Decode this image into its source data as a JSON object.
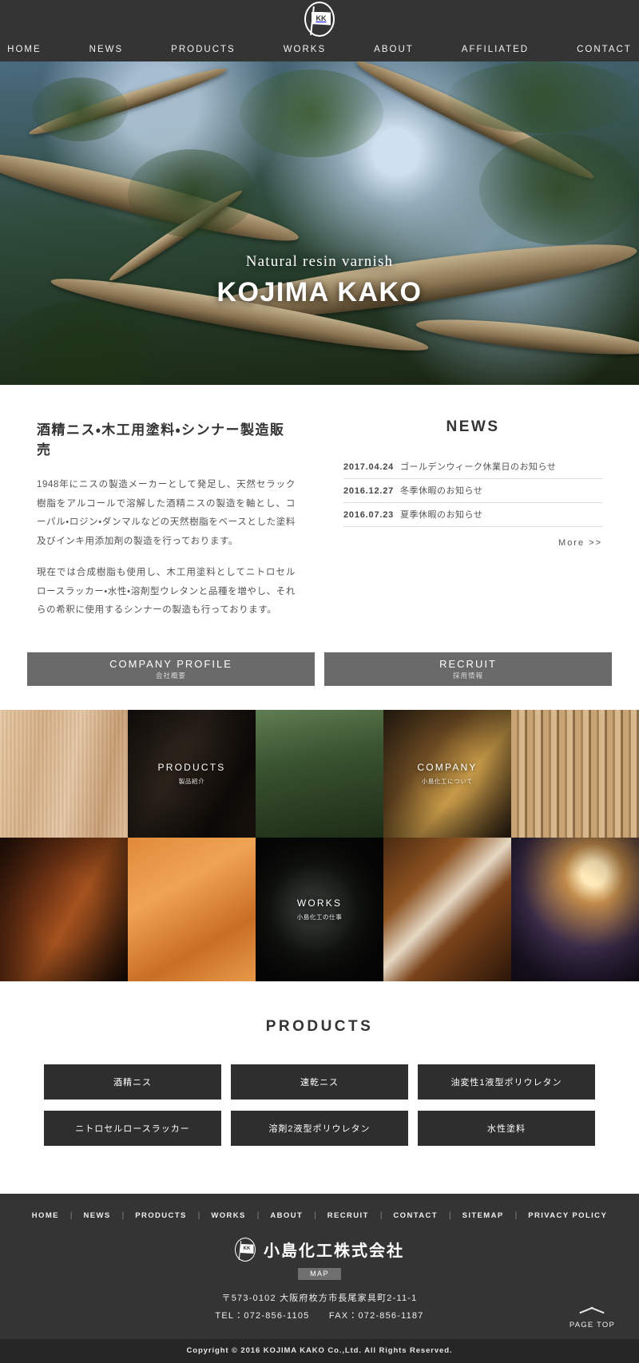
{
  "header": {
    "logo": {
      "mark": "KK",
      "name": "kojima-kako-logo"
    },
    "nav": [
      {
        "label": "HOME"
      },
      {
        "label": "NEWS"
      },
      {
        "label": "PRODUCTS"
      },
      {
        "label": "WORKS"
      },
      {
        "label": "ABOUT"
      },
      {
        "label": "AFFILIATED"
      },
      {
        "label": "CONTACT"
      }
    ]
  },
  "hero": {
    "subtitle": "Natural resin varnish",
    "title": "KOJIMA KAKO"
  },
  "intro": {
    "heading": "酒精ニス・木工用塗料・シンナー製造販売",
    "paragraph1": "1948年にニスの製造メーカーとして発足し、天然セラック樹脂をアルコールで溶解した酒精ニスの製造を軸とし、コーパル・ロジン・ダンマルなどの天然樹脂をベースとした塗料及びインキ用添加剤の製造を行っております。",
    "paragraph2": "現在では合成樹脂も使用し、木工用塗料としてニトロセルロースラッカー・水性・溶剤型ウレタンと品種を増やし、それらの希釈に使用するシンナーの製造も行っております。"
  },
  "news": {
    "heading": "NEWS",
    "items": [
      {
        "date": "2017.04.24",
        "title": "ゴールデンウィーク休業日のお知らせ"
      },
      {
        "date": "2016.12.27",
        "title": "冬季休暇のお知らせ"
      },
      {
        "date": "2016.07.23",
        "title": "夏季休暇のお知らせ"
      }
    ],
    "more": "More >>"
  },
  "cta": [
    {
      "main": "COMPANY PROFILE",
      "sub": "会社概要"
    },
    {
      "main": "RECRUIT",
      "sub": "採用情報"
    }
  ],
  "grid_tiles": [
    {
      "caption": "",
      "sub": "",
      "texture": "tx-wood-light"
    },
    {
      "caption": "PRODUCTS",
      "sub": "製品紹介",
      "texture": "tx-dark-wood"
    },
    {
      "caption": "",
      "sub": "",
      "texture": "tx-tree"
    },
    {
      "caption": "COMPANY",
      "sub": "小島化工について",
      "texture": "tx-chairs"
    },
    {
      "caption": "",
      "sub": "",
      "texture": "tx-fence"
    },
    {
      "caption": "",
      "sub": "",
      "texture": "tx-violin"
    },
    {
      "caption": "",
      "sub": "",
      "texture": "tx-table"
    },
    {
      "caption": "WORKS",
      "sub": "小島化工の仕事",
      "texture": "tx-swirl"
    },
    {
      "caption": "",
      "sub": "",
      "texture": "tx-curve"
    },
    {
      "caption": "",
      "sub": "",
      "texture": "tx-lamp"
    }
  ],
  "products": {
    "heading": "PRODUCTS",
    "items": [
      {
        "label": "酒精ニス"
      },
      {
        "label": "速乾ニス"
      },
      {
        "label": "油変性1液型ポリウレタン"
      },
      {
        "label": "ニトロセルロースラッカー"
      },
      {
        "label": "溶剤2液型ポリウレタン"
      },
      {
        "label": "水性塗料"
      }
    ]
  },
  "footer": {
    "nav": [
      {
        "label": "HOME"
      },
      {
        "label": "NEWS"
      },
      {
        "label": "PRODUCTS"
      },
      {
        "label": "WORKS"
      },
      {
        "label": "ABOUT"
      },
      {
        "label": "RECRUIT"
      },
      {
        "label": "CONTACT"
      },
      {
        "label": "SITEMAP"
      },
      {
        "label": "PRIVACY POLICY"
      }
    ],
    "logo_mark": "KK",
    "company_name": "小島化工株式会社",
    "map_label": "MAP",
    "address": "〒573-0102 大阪府枚方市長尾家具町2-11-1",
    "phone_fax": "TEL：072-856-1105　　FAX：072-856-1187",
    "page_top": "PAGE TOP",
    "copyright": "Copyright © 2016 KOJIMA KAKO Co.,Ltd. All Rights Reserved."
  },
  "colors": {
    "dark": "#343434",
    "darker": "#262626",
    "button_gray": "#6a6a6a",
    "product_btn": "#2e2e2e"
  }
}
